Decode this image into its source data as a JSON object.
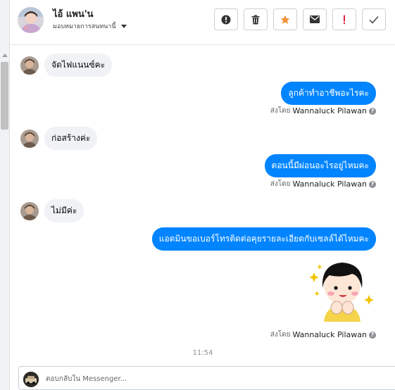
{
  "contact": {
    "name": "ไอ้ แพน'น",
    "assign_label": "มอบหมายการสนทนานี้"
  },
  "actions": [
    {
      "name": "report-spam-button",
      "icon": "exclamation-circle-icon"
    },
    {
      "name": "delete-button",
      "icon": "trash-icon"
    },
    {
      "name": "star-button",
      "icon": "star-icon"
    },
    {
      "name": "mark-unread-button",
      "icon": "envelope-icon"
    },
    {
      "name": "follow-up-button",
      "icon": "exclamation-icon"
    },
    {
      "name": "mark-done-button",
      "icon": "check-icon"
    }
  ],
  "messages": [
    {
      "direction": "in",
      "text": "จัดไฟแนนซ์คะ"
    },
    {
      "direction": "out",
      "text": "ลูกค้าทำอาชีพอะไรคะ",
      "sent_by_label": "ส่งโดย",
      "sender": "Wannaluck Pilawan"
    },
    {
      "direction": "in",
      "text": "ก่อสร้างค่ะ"
    },
    {
      "direction": "out",
      "text": "ตอนนี้มีผ่อนอะไรอยู่ไหมคะ",
      "sent_by_label": "ส่งโดย",
      "sender": "Wannaluck Pilawan"
    },
    {
      "direction": "in",
      "text": "ไม่มีค่ะ"
    },
    {
      "direction": "out",
      "text": "แอดมินขอเบอร์โทรติดต่อคุยรายละเอียดกับเซลล์ได้ไหมคะ"
    },
    {
      "direction": "out",
      "type": "sticker",
      "sent_by_label": "ส่งโดย",
      "sender": "Wannaluck Pilawan"
    }
  ],
  "timestamp": "11:54",
  "composer": {
    "placeholder": "ตอบกลับใน Messenger..."
  },
  "colors": {
    "outgoing_bubble": "#0084ff",
    "incoming_bubble": "#f0f2f5",
    "star": "#f7923a",
    "follow_up": "#e41e3f"
  }
}
